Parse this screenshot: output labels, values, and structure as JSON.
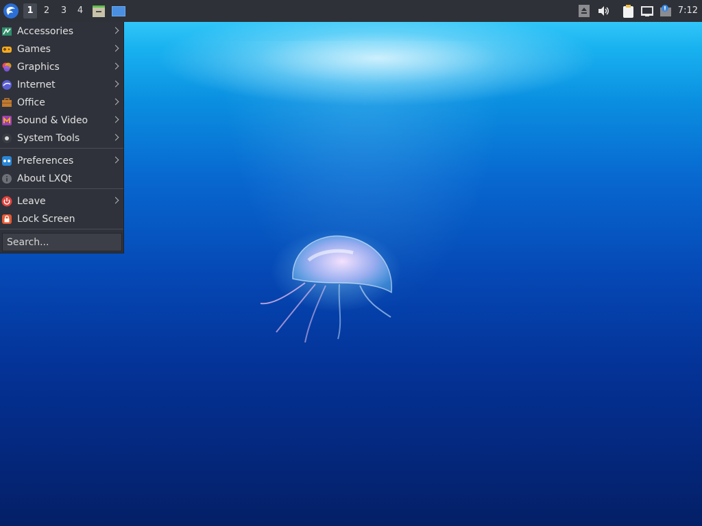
{
  "panel": {
    "launcher_icon": "lxqt-logo-icon",
    "desktops": [
      "1",
      "2",
      "3",
      "4"
    ],
    "active_desktop": "1",
    "quicklaunch": [
      {
        "icon": "file-manager-icon"
      },
      {
        "icon": "show-desktop-icon"
      }
    ],
    "tray": [
      {
        "icon": "eject-icon"
      },
      {
        "icon": "volume-icon"
      },
      {
        "icon": "clipboard-icon"
      },
      {
        "icon": "network-icon"
      },
      {
        "icon": "notification-icon"
      }
    ],
    "clock": "7:12"
  },
  "menu": {
    "groups": [
      [
        {
          "label": "Accessories",
          "icon": "accessories-icon",
          "submenu": true
        },
        {
          "label": "Games",
          "icon": "games-icon",
          "submenu": true
        },
        {
          "label": "Graphics",
          "icon": "graphics-icon",
          "submenu": true
        },
        {
          "label": "Internet",
          "icon": "internet-icon",
          "submenu": true
        },
        {
          "label": "Office",
          "icon": "office-icon",
          "submenu": true
        },
        {
          "label": "Sound & Video",
          "icon": "sound-video-icon",
          "submenu": true
        },
        {
          "label": "System Tools",
          "icon": "system-tools-icon",
          "submenu": true
        }
      ],
      [
        {
          "label": "Preferences",
          "icon": "preferences-icon",
          "submenu": true
        },
        {
          "label": "About LXQt",
          "icon": "info-icon",
          "submenu": false
        }
      ],
      [
        {
          "label": "Leave",
          "icon": "power-icon",
          "submenu": true
        },
        {
          "label": "Lock Screen",
          "icon": "lock-icon",
          "submenu": false
        }
      ]
    ],
    "search_placeholder": "Search..."
  },
  "colors": {
    "panel_bg": "#2e3138",
    "menu_bg": "#2f323a",
    "menu_text": "#e2e2e2",
    "accent_blue": "#4a8fe0"
  }
}
